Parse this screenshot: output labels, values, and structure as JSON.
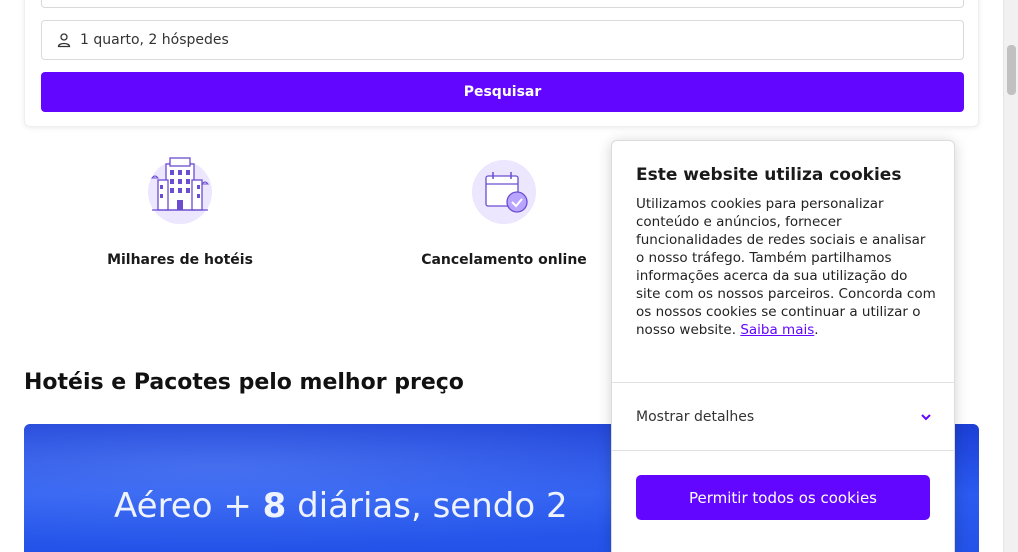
{
  "search": {
    "guests_value": "1 quarto, 2 hóspedes",
    "search_button": "Pesquisar"
  },
  "features": [
    {
      "label": "Milhares de hotéis",
      "icon": "hotel-building-icon"
    },
    {
      "label": "Cancelamento online",
      "icon": "calendar-check-icon"
    }
  ],
  "section": {
    "title": "Hotéis e Pacotes pelo melhor preço"
  },
  "banner": {
    "text_prefix": "Aéreo + ",
    "text_bold": "8",
    "text_suffix": " diárias, sendo 2"
  },
  "cookie": {
    "title": "Este website utiliza cookies",
    "body": "Utilizamos cookies para personalizar conteúdo e anúncios, fornecer funcionalidades de redes sociais e analisar o nosso tráfego. Também partilhamos informações acerca da sua utilização do site com os nossos parceiros. Concorda com os nossos cookies se continuar a utilizar o nosso website. ",
    "learn_more": "Saiba mais",
    "period": ".",
    "show_details": "Mostrar detalhes",
    "allow_all": "Permitir todos os cookies"
  },
  "colors": {
    "accent": "#6306ff",
    "banner": "#2151e6"
  }
}
